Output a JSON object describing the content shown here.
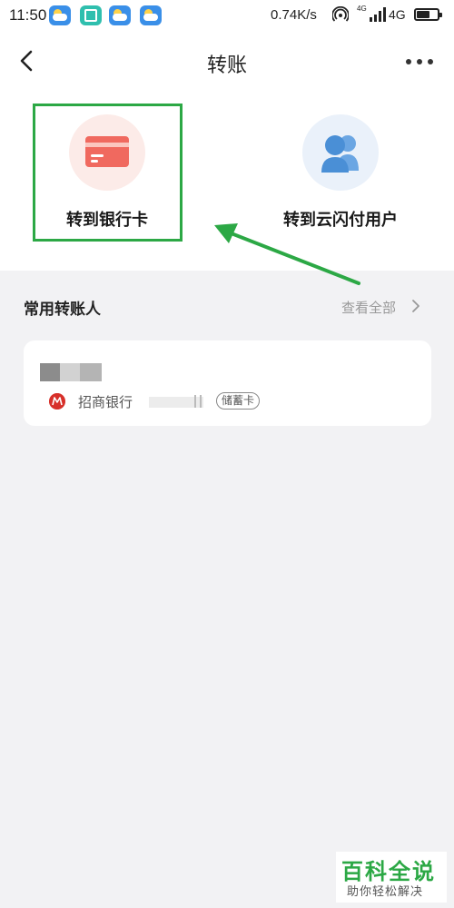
{
  "status_bar": {
    "time": "11:50",
    "network_speed": "0.74K/s",
    "network_type_small": "4G",
    "network_type": "4G"
  },
  "header": {
    "title": "转账",
    "back_icon": "chevron-left-icon",
    "more_icon": "more-dots-icon"
  },
  "options": [
    {
      "label": "转到银行卡",
      "icon": "bank-card-icon",
      "color": "#f0695f",
      "highlighted": true
    },
    {
      "label": "转到云闪付用户",
      "icon": "users-icon",
      "color": "#4a8fd6",
      "highlighted": false
    }
  ],
  "frequent": {
    "title": "常用转账人",
    "view_all": "查看全部",
    "payees": [
      {
        "bank": "招商银行",
        "card_type": "储蓄卡",
        "bank_color": "#d7302a"
      }
    ]
  },
  "watermark": {
    "title": "百科全说",
    "subtitle": "助你轻松解决"
  },
  "colors": {
    "accent_green": "#2ca845",
    "background": "#f2f2f4"
  }
}
